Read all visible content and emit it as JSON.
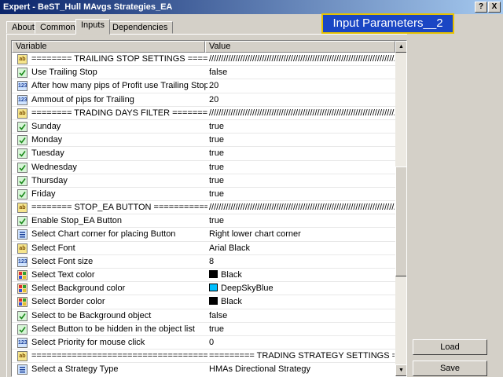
{
  "window": {
    "title": "Expert - BeST_Hull MAvgs Strategies_EA",
    "help_label": "?",
    "close_label": "X"
  },
  "tabs": [
    {
      "label": "About"
    },
    {
      "label": "Common"
    },
    {
      "label": "Inputs"
    },
    {
      "label": "Dependencies"
    }
  ],
  "active_tab": "Inputs",
  "annotation": "Input Parameters__2",
  "grid": {
    "headers": {
      "variable": "Variable",
      "value": "Value"
    },
    "rows": [
      {
        "type": "ab",
        "name": "========   TRAILING STOP SETTINGS   ======================",
        "value": "//////////////////////////////////////////////////////////////////////////////"
      },
      {
        "type": "bool",
        "name": "Use Trailing Stop",
        "value": "false"
      },
      {
        "type": "num",
        "name": "After how many pips of Profit use Trailing Stop",
        "value": "20"
      },
      {
        "type": "num",
        "name": "Ammout of pips for Trailing",
        "value": "20"
      },
      {
        "type": "ab",
        "name": "========   TRADING DAYS FILTER   ========================",
        "value": "//////////////////////////////////////////////////////////////////////////////"
      },
      {
        "type": "bool",
        "name": "Sunday",
        "value": "true"
      },
      {
        "type": "bool",
        "name": "Monday",
        "value": "true"
      },
      {
        "type": "bool",
        "name": "Tuesday",
        "value": "true"
      },
      {
        "type": "bool",
        "name": "Wednesday",
        "value": "true"
      },
      {
        "type": "bool",
        "name": "Thursday",
        "value": "true"
      },
      {
        "type": "bool",
        "name": "Friday",
        "value": "true"
      },
      {
        "type": "ab",
        "name": "========   STOP_EA BUTTON   =============================",
        "value": "//////////////////////////////////////////////////////////////////////////////"
      },
      {
        "type": "bool",
        "name": "Enable Stop_EA Button",
        "value": "true"
      },
      {
        "type": "en",
        "name": "Select Chart corner for placing Button",
        "value": "Right lower chart corner"
      },
      {
        "type": "ab",
        "name": "Select Font",
        "value": "Arial Black"
      },
      {
        "type": "num",
        "name": "Select Font size",
        "value": "8"
      },
      {
        "type": "col",
        "name": "Select Text color",
        "value": "Black",
        "swatch": "#000000"
      },
      {
        "type": "col",
        "name": "Select Background color",
        "value": "DeepSkyBlue",
        "swatch": "#00bfff"
      },
      {
        "type": "col",
        "name": "Select Border color",
        "value": "Black",
        "swatch": "#000000"
      },
      {
        "type": "bool",
        "name": "Select to be Background object",
        "value": "false"
      },
      {
        "type": "bool",
        "name": "Select Button to be hidden in the object list",
        "value": "true"
      },
      {
        "type": "num",
        "name": "Select Priority for mouse click",
        "value": "0"
      },
      {
        "type": "ab",
        "name": "=====================================================",
        "value": "=========   TRADING STRATEGY SETTINGS   =================="
      },
      {
        "type": "en",
        "name": "Select a Strategy Type",
        "value": "HMAs Directional Strategy"
      }
    ]
  },
  "buttons": {
    "load": "Load",
    "save": "Save"
  },
  "icons": {
    "ab": "string-param-icon",
    "bool": "bool-param-icon",
    "num": "number-param-icon",
    "col": "color-param-icon",
    "en": "enum-param-icon"
  },
  "icon_text": {
    "ab": "ab",
    "num": "123"
  }
}
